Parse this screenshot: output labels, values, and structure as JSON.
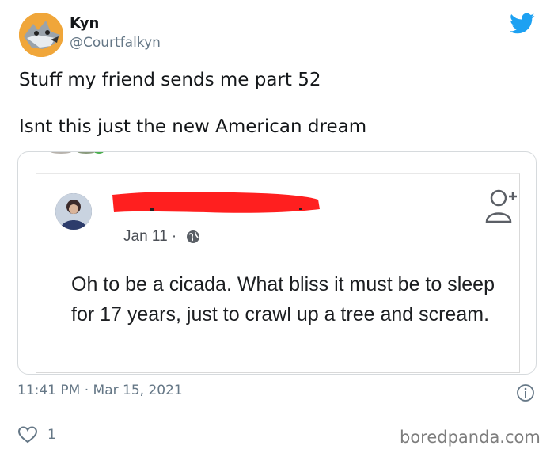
{
  "author": {
    "name": "Kyn",
    "handle": "@Courtfalkyn"
  },
  "tweet": {
    "line1": "Stuff my friend sends me part 52",
    "line2": "Isnt this just the new American dream"
  },
  "embedded_post": {
    "date": "Jan 11",
    "separator": "·",
    "text": "Oh to be a cicada. What bliss it must be to sleep for 17 years, just to crawl up a tree and scream."
  },
  "meta": {
    "time": "11:41 PM · Mar 15, 2021"
  },
  "engagement": {
    "likes": "1"
  },
  "watermark": "boredpanda.com",
  "colors": {
    "twitter_blue": "#1da1f2",
    "secondary_text": "#657786",
    "redaction": "#ff1f1f"
  },
  "icons": [
    "twitter-bird-icon",
    "globe-icon",
    "add-friend-icon",
    "info-icon",
    "heart-icon"
  ]
}
